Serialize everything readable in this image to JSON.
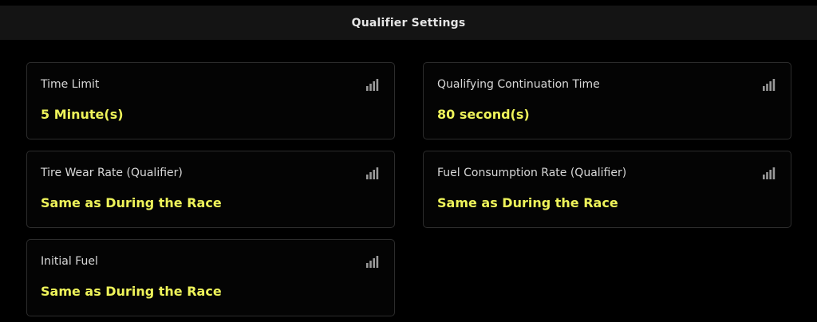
{
  "header": {
    "title": "Qualifier Settings"
  },
  "settings": [
    {
      "label": "Time Limit",
      "value": "5 Minute(s)",
      "icon": "signal-bars-icon"
    },
    {
      "label": "Qualifying Continuation Time",
      "value": "80 second(s)",
      "icon": "signal-bars-icon"
    },
    {
      "label": "Tire Wear Rate (Qualifier)",
      "value": "Same as During the Race",
      "icon": "signal-bars-icon"
    },
    {
      "label": "Fuel Consumption Rate (Qualifier)",
      "value": "Same as During the Race",
      "icon": "signal-bars-icon"
    },
    {
      "label": "Initial Fuel",
      "value": "Same as During the Race",
      "icon": "signal-bars-icon"
    }
  ],
  "colors": {
    "value_accent": "#eef35a",
    "label_text": "#d8d8d8",
    "header_bg": "#141414",
    "card_border": "#2c2c2c",
    "background": "#000000"
  }
}
